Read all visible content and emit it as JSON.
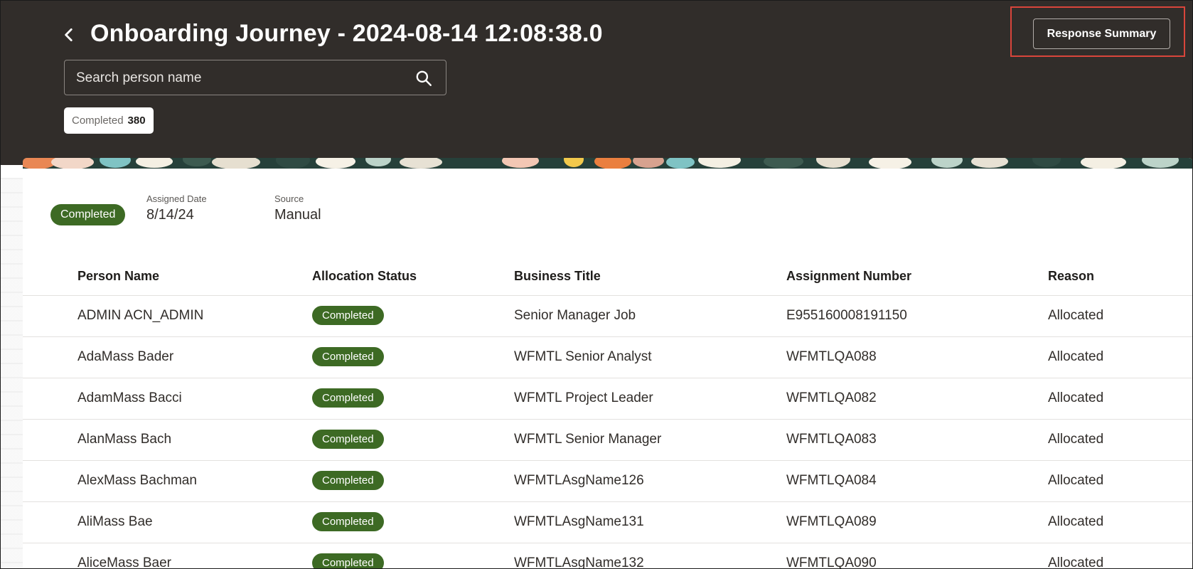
{
  "header": {
    "title": "Onboarding Journey - 2024-08-14 12:08:38.0",
    "search_placeholder": "Search person name",
    "filter_chip": {
      "label": "Completed",
      "count": "380"
    },
    "response_summary_label": "Response Summary"
  },
  "summary": {
    "status": "Completed",
    "assigned_date_label": "Assigned Date",
    "assigned_date": "8/14/24",
    "source_label": "Source",
    "source": "Manual"
  },
  "table": {
    "columns": [
      "Person Name",
      "Allocation Status",
      "Business Title",
      "Assignment Number",
      "Reason"
    ],
    "rows": [
      {
        "person": "ADMIN ACN_ADMIN",
        "status": "Completed",
        "title": "Senior Manager Job",
        "assignment": "E955160008191150",
        "reason": "Allocated"
      },
      {
        "person": "AdaMass Bader",
        "status": "Completed",
        "title": "WFMTL Senior Analyst",
        "assignment": "WFMTLQA088",
        "reason": "Allocated"
      },
      {
        "person": "AdamMass Bacci",
        "status": "Completed",
        "title": "WFMTL Project Leader",
        "assignment": "WFMTLQA082",
        "reason": "Allocated"
      },
      {
        "person": "AlanMass Bach",
        "status": "Completed",
        "title": "WFMTL Senior Manager",
        "assignment": "WFMTLQA083",
        "reason": "Allocated"
      },
      {
        "person": "AlexMass Bachman",
        "status": "Completed",
        "title": "WFMTLAsgName126",
        "assignment": "WFMTLQA084",
        "reason": "Allocated"
      },
      {
        "person": "AliMass Bae",
        "status": "Completed",
        "title": "WFMTLAsgName131",
        "assignment": "WFMTLQA089",
        "reason": "Allocated"
      },
      {
        "person": "AliceMass Baer",
        "status": "Completed",
        "title": "WFMTLAsgName132",
        "assignment": "WFMTLQA090",
        "reason": "Allocated"
      }
    ]
  },
  "colors": {
    "header_bg": "#312d2a",
    "status_green": "#3d6a24",
    "highlight_red": "#d9453b"
  },
  "icons": [
    "chevron-left-icon",
    "search-icon"
  ]
}
